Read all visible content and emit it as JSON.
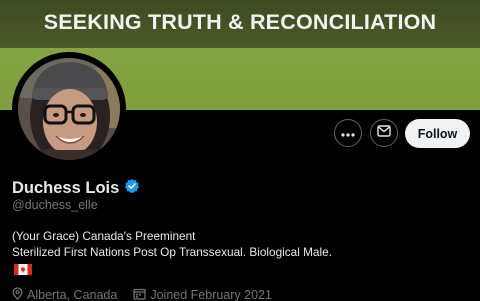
{
  "banner": {
    "text": "SEEKING TRUTH & RECONCILIATION"
  },
  "profile": {
    "display_name": "Duchess Lois",
    "handle": "@duchess_elle",
    "verified": true,
    "bio_line1": "(Your Grace) Canada's Preeminent",
    "bio_line2": "Sterilized First Nations Post Op Transsexual. Biological Male.",
    "bio_flag": "canada-flag-icon",
    "location": "Alberta, Canada",
    "joined": "Joined February 2021"
  },
  "actions": {
    "more_icon": "more-icon",
    "message_icon": "envelope-icon",
    "follow_label": "Follow"
  },
  "colors": {
    "background": "#000000",
    "text_primary": "#e7e9ea",
    "text_secondary": "#71767b",
    "verified_blue": "#1d9bf0",
    "follow_bg": "#eff3f4",
    "banner_green": "#86a442",
    "banner_strip": "#44522a"
  }
}
